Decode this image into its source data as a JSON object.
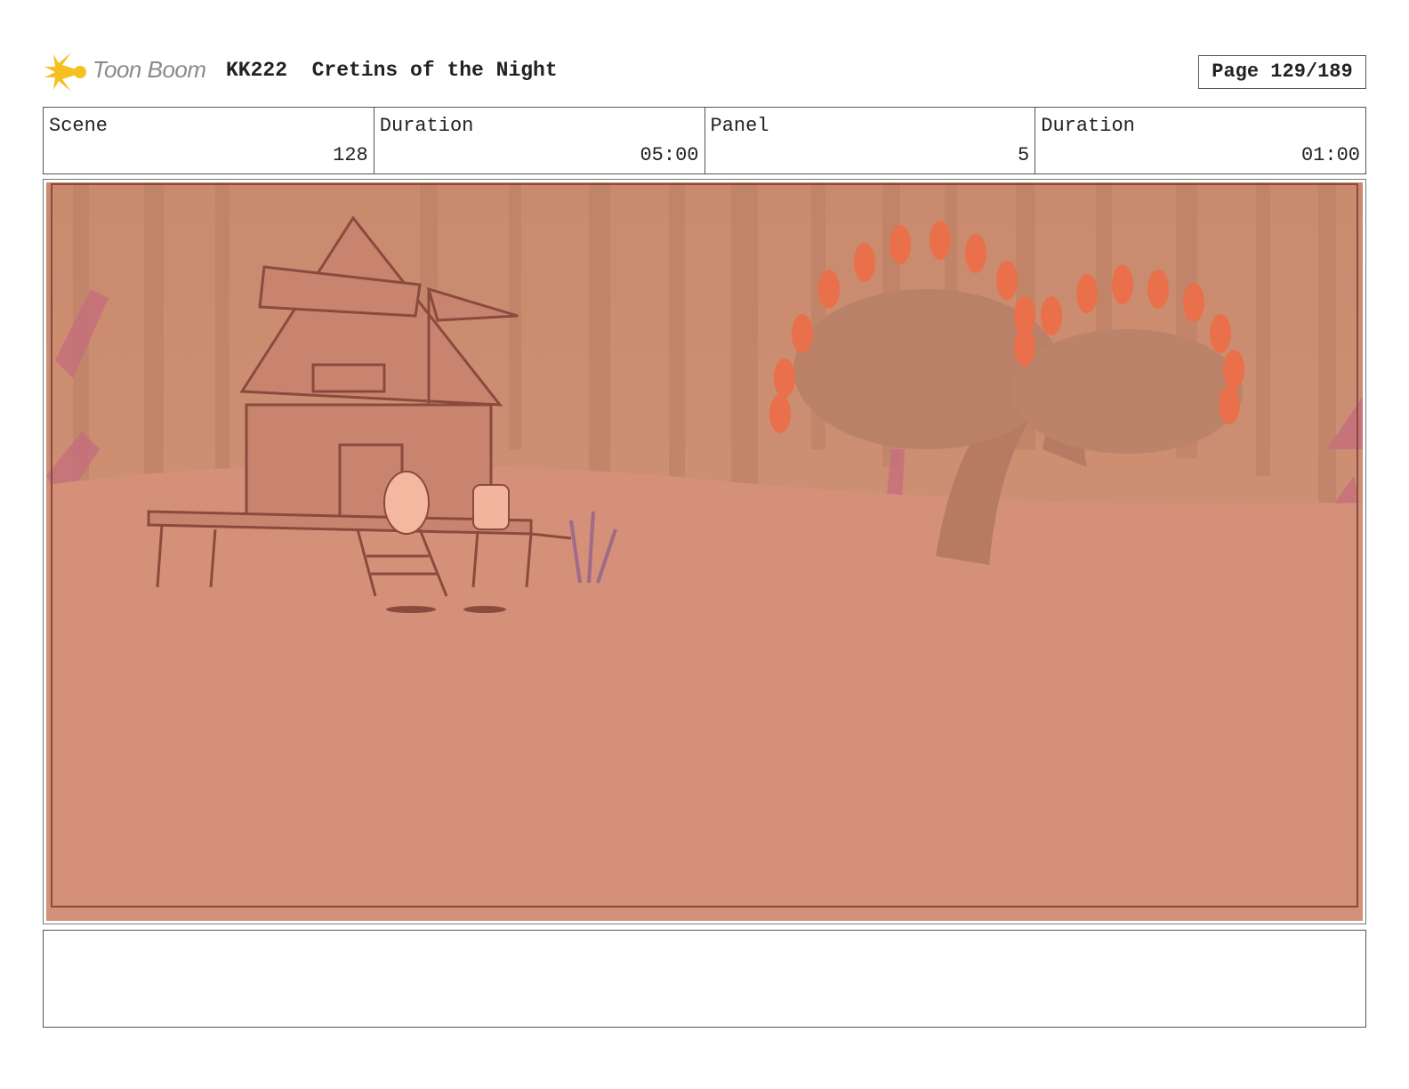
{
  "header": {
    "logo_text": "Toon Boom",
    "title": "KK222  Cretins of the Night",
    "page": "Page 129/189"
  },
  "info": {
    "scene_label": "Scene",
    "scene_value": "128",
    "duration_label": "Duration",
    "duration_value": "05:00",
    "panel_label": "Panel",
    "panel_value": "5",
    "panel_duration_label": "Duration",
    "panel_duration_value": "01:00"
  },
  "notes": "",
  "colors": {
    "ground": "#d49078",
    "background": "#cf8f72",
    "sketch_line": "#8a4a3e",
    "mushroom_fringe": "#e9704a"
  }
}
